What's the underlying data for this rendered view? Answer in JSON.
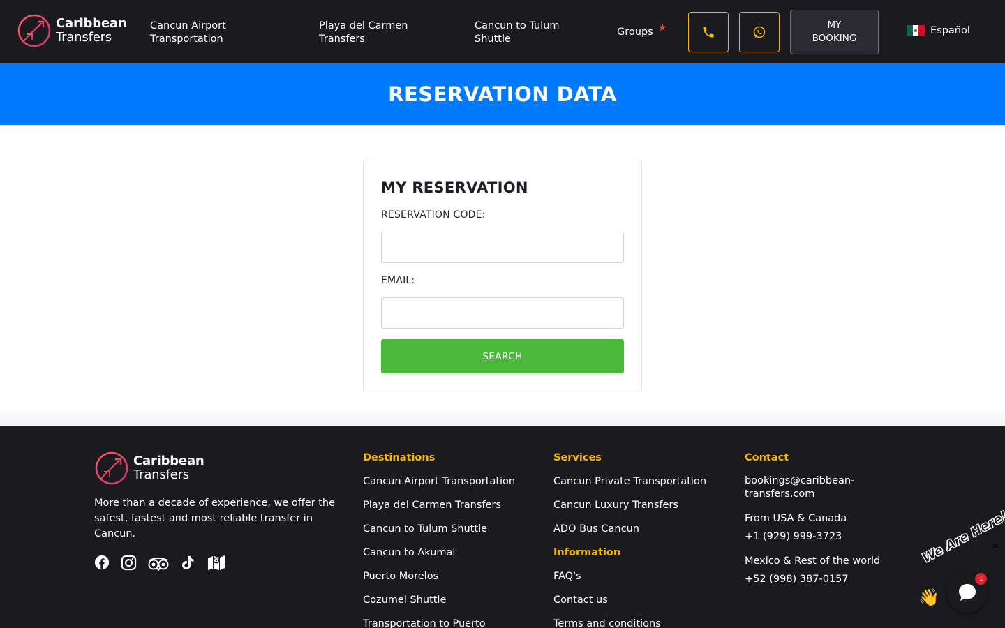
{
  "brand": {
    "line1": "Caribbean",
    "line2": "Transfers"
  },
  "nav": {
    "airport": {
      "line1": "Cancun Airport",
      "line2": "Transportation"
    },
    "playa": {
      "line1": "Playa del Carmen",
      "line2": "Transfers"
    },
    "tulum": {
      "line1": "Cancun to Tulum",
      "line2": "Shuttle"
    },
    "groups": "Groups",
    "booking": {
      "line1": "MY",
      "line2": "BOOKING"
    },
    "language": "Español"
  },
  "banner": {
    "title": "RESERVATION DATA"
  },
  "reservation": {
    "title": "MY RESERVATION",
    "code_label": "RESERVATION CODE:",
    "code_value": "",
    "email_label": "EMAIL:",
    "email_value": "",
    "search_label": "SEARCH"
  },
  "footer": {
    "description": "More than a decade of experience, we offer the safest, fastest and most reliable transfer in Cancun.",
    "destinations": {
      "heading": "Destinations",
      "links": [
        "Cancun Airport Transportation",
        "Playa del Carmen Transfers",
        "Cancun to Tulum Shuttle",
        "Cancun to Akumal",
        "Puerto Morelos",
        "Cozumel Shuttle",
        "Transportation to Puerto"
      ]
    },
    "services": {
      "heading": "Services",
      "links": [
        "Cancun Private Transportation",
        "Cancun Luxury Transfers",
        "ADO Bus Cancun"
      ]
    },
    "information": {
      "heading": "Information",
      "links": [
        "FAQ's",
        "Contact us",
        "Terms and conditions"
      ]
    },
    "contact": {
      "heading": "Contact",
      "email_line1": "bookings@caribbean-",
      "email_line2": "transfers.com",
      "usa_label": "From USA & Canada",
      "usa_phone": "+1 (929) 999-3723",
      "mx_label": "Mexico & Rest of the world",
      "mx_phone": "+52 (998) 387-0157"
    }
  },
  "chat": {
    "banner_text": "We Are Here!",
    "unread_count": "1"
  },
  "colors": {
    "header_bg": "#1b1a1f",
    "banner_bg": "#007bff",
    "accent": "#f5b800",
    "search_button": "#4cb93c"
  }
}
